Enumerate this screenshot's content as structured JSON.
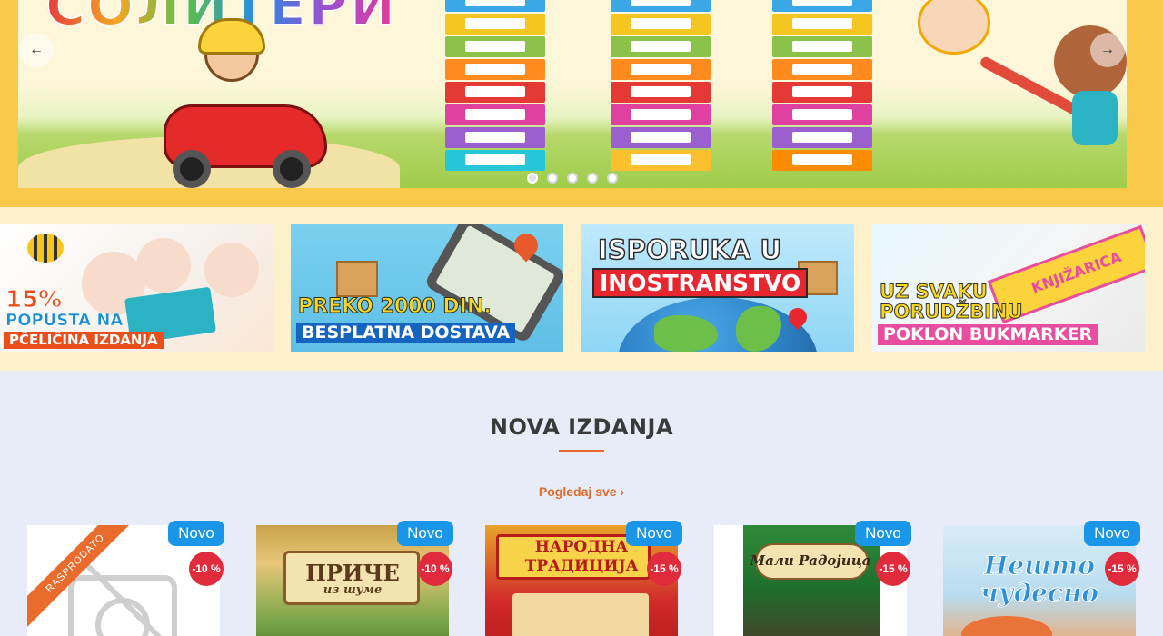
{
  "hero": {
    "title_art": "СОЛИТЕРИ",
    "prev_icon": "arrow-left-icon",
    "next_icon": "arrow-right-icon",
    "prev_glyph": "←",
    "next_glyph": "→",
    "slides_count": 5,
    "active_slide": 1
  },
  "promos": [
    {
      "line1": "15%",
      "line2": "POPUSTA NA",
      "line3": "PČELIČINA IZDANJA"
    },
    {
      "line1": "PREKO 2000 DIN.",
      "line2": "BESPLATNA DOSTAVA"
    },
    {
      "line1": "ISPORUKA U",
      "line2": "INOSTRANSTVO"
    },
    {
      "line1": "UZ SVAKU",
      "line2": "PORUDŽBINU",
      "line3": "POKLON BUKMARKER",
      "ribbon": "KNJIŽARICA"
    }
  ],
  "new_editions": {
    "title": "NOVA IZDANJA",
    "see_all": "Pogledaj sve",
    "see_all_icon": "›",
    "products": [
      {
        "badge": "Novo",
        "discount": "-10 %",
        "sold_out": "RASPRODATO",
        "cover_title": ""
      },
      {
        "badge": "Novo",
        "discount": "-10 %",
        "cover_title": "ПРИЧЕ",
        "cover_sub": "из шуме"
      },
      {
        "badge": "Novo",
        "discount": "-15 %",
        "cover_title": "НАРОДНА",
        "cover_sub": "ТРАДИЦИЈА"
      },
      {
        "badge": "Novo",
        "discount": "-15 %",
        "cover_title": "Мали Радојица"
      },
      {
        "badge": "Novo",
        "discount": "-15 %",
        "cover_title": "Нешто",
        "cover_sub": "чудесно"
      }
    ]
  },
  "colors": {
    "hero_frame": "#fbc94a",
    "promo_bg": "#fdf1cc",
    "section_bg": "#e8ecf8",
    "accent_orange": "#ea6c2c",
    "badge_blue": "#1a96e8",
    "discount_red": "#e02b3c"
  }
}
